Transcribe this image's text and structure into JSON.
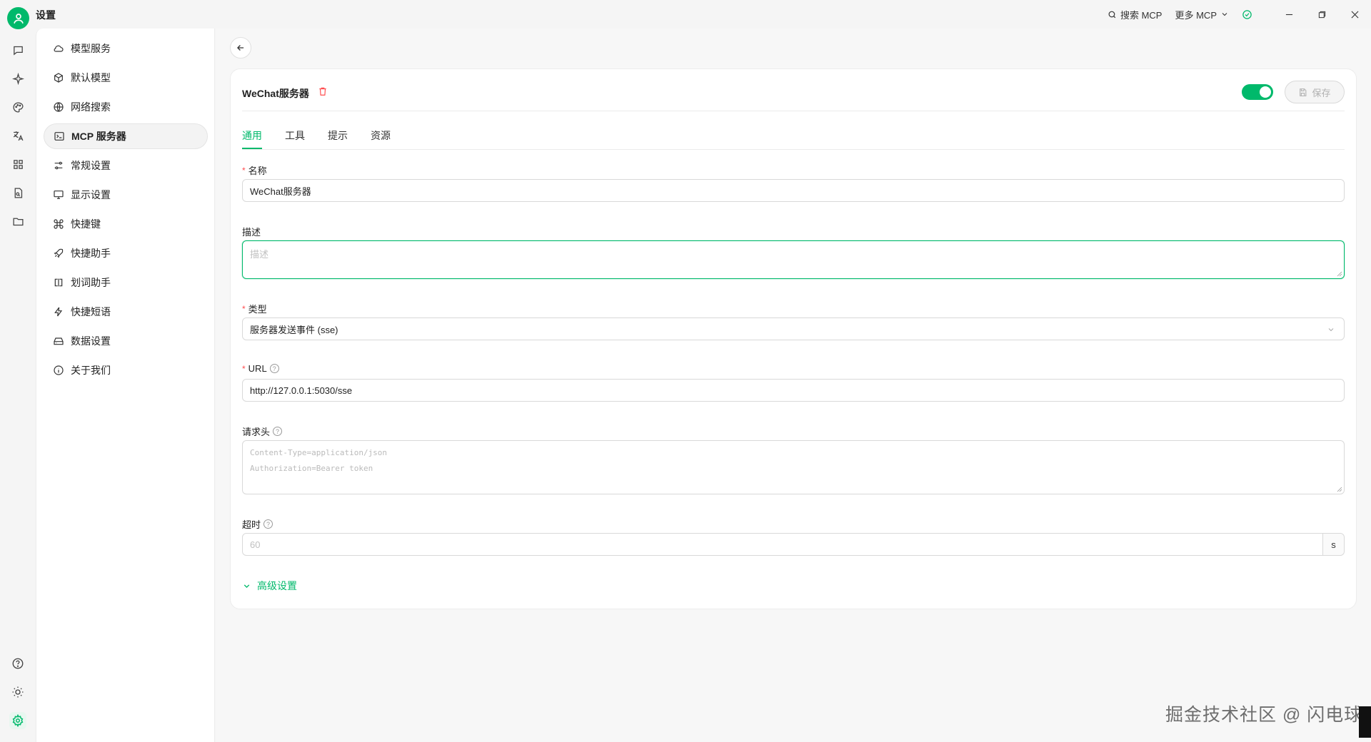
{
  "app": {
    "title": "设置"
  },
  "titlebar": {
    "search_label": "搜索 MCP",
    "more_label": "更多 MCP"
  },
  "nav": {
    "items": [
      {
        "label": "模型服务",
        "icon": "cloud-icon"
      },
      {
        "label": "默认模型",
        "icon": "cube-icon"
      },
      {
        "label": "网络搜索",
        "icon": "globe-icon"
      },
      {
        "label": "MCP 服务器",
        "icon": "terminal-icon",
        "active": true
      },
      {
        "label": "常规设置",
        "icon": "sliders-icon"
      },
      {
        "label": "显示设置",
        "icon": "monitor-icon"
      },
      {
        "label": "快捷键",
        "icon": "command-icon"
      },
      {
        "label": "快捷助手",
        "icon": "rocket-icon"
      },
      {
        "label": "划词助手",
        "icon": "text-select-icon"
      },
      {
        "label": "快捷短语",
        "icon": "zap-icon"
      },
      {
        "label": "数据设置",
        "icon": "hard-drive-icon"
      },
      {
        "label": "关于我们",
        "icon": "info-icon"
      }
    ]
  },
  "server": {
    "title": "WeChat服务器",
    "enabled": true,
    "save_label": "保存",
    "tabs": [
      "通用",
      "工具",
      "提示",
      "资源"
    ],
    "name_label": "名称",
    "name_value": "WeChat服务器",
    "desc_label": "描述",
    "desc_placeholder": "描述",
    "type_label": "类型",
    "type_value": "服务器发送事件 (sse)",
    "url_label": "URL",
    "url_value": "http://127.0.0.1:5030/sse",
    "headers_label": "请求头",
    "headers_placeholder_line1": "Content-Type=application/json",
    "headers_placeholder_line2": "Authorization=Bearer token",
    "timeout_label": "超时",
    "timeout_placeholder": "60",
    "timeout_unit": "s",
    "advanced_label": "高级设置"
  },
  "watermark": "掘金技术社区 @ 闪电球",
  "colors": {
    "accent": "#00b96b",
    "required": "#ff4d4f"
  }
}
